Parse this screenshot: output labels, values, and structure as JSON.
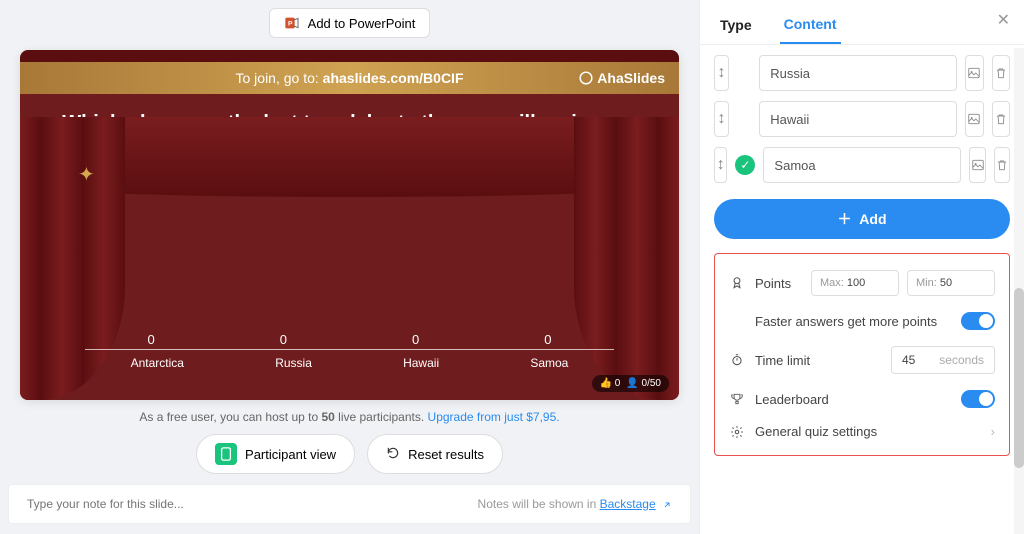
{
  "toolbar": {
    "pp_label": "Add to PowerPoint"
  },
  "slide": {
    "join_prefix": "To join, go to: ",
    "join_code": "ahaslides.com/B0CIF",
    "brand": "AhaSlides",
    "question": "Which place was the last to celebrate the new millennium on Jan. 1, 2000?",
    "audience_left": "0",
    "audience_right": "0/50"
  },
  "chart_data": {
    "type": "bar",
    "categories": [
      "Antarctica",
      "Russia",
      "Hawaii",
      "Samoa"
    ],
    "values": [
      0,
      0,
      0,
      0
    ],
    "title": "",
    "xlabel": "",
    "ylabel": "",
    "ylim": [
      0,
      0
    ]
  },
  "notice": {
    "text": "As a free user, you can host up to ",
    "bold": "50",
    "suffix": " live participants.  ",
    "upgrade": "Upgrade from just $7,95."
  },
  "actions": {
    "participant": "Participant view",
    "reset": "Reset results"
  },
  "notes": {
    "placeholder": "Type your note for this slide...",
    "hint_prefix": "Notes will be shown in ",
    "backstage": "Backstage"
  },
  "tabs": {
    "type": "Type",
    "content": "Content"
  },
  "options": [
    {
      "text": "Russia",
      "correct": false
    },
    {
      "text": "Hawaii",
      "correct": false
    },
    {
      "text": "Samoa",
      "correct": true
    }
  ],
  "add_label": "Add",
  "settings": {
    "points_label": "Points",
    "points_max_prefix": "Max: ",
    "points_max": "100",
    "points_min_prefix": "Min: ",
    "points_min": "50",
    "faster_label": "Faster answers get more points",
    "time_label": "Time limit",
    "time_value": "45",
    "time_unit": "seconds",
    "leaderboard_label": "Leaderboard",
    "general_label": "General quiz settings"
  }
}
